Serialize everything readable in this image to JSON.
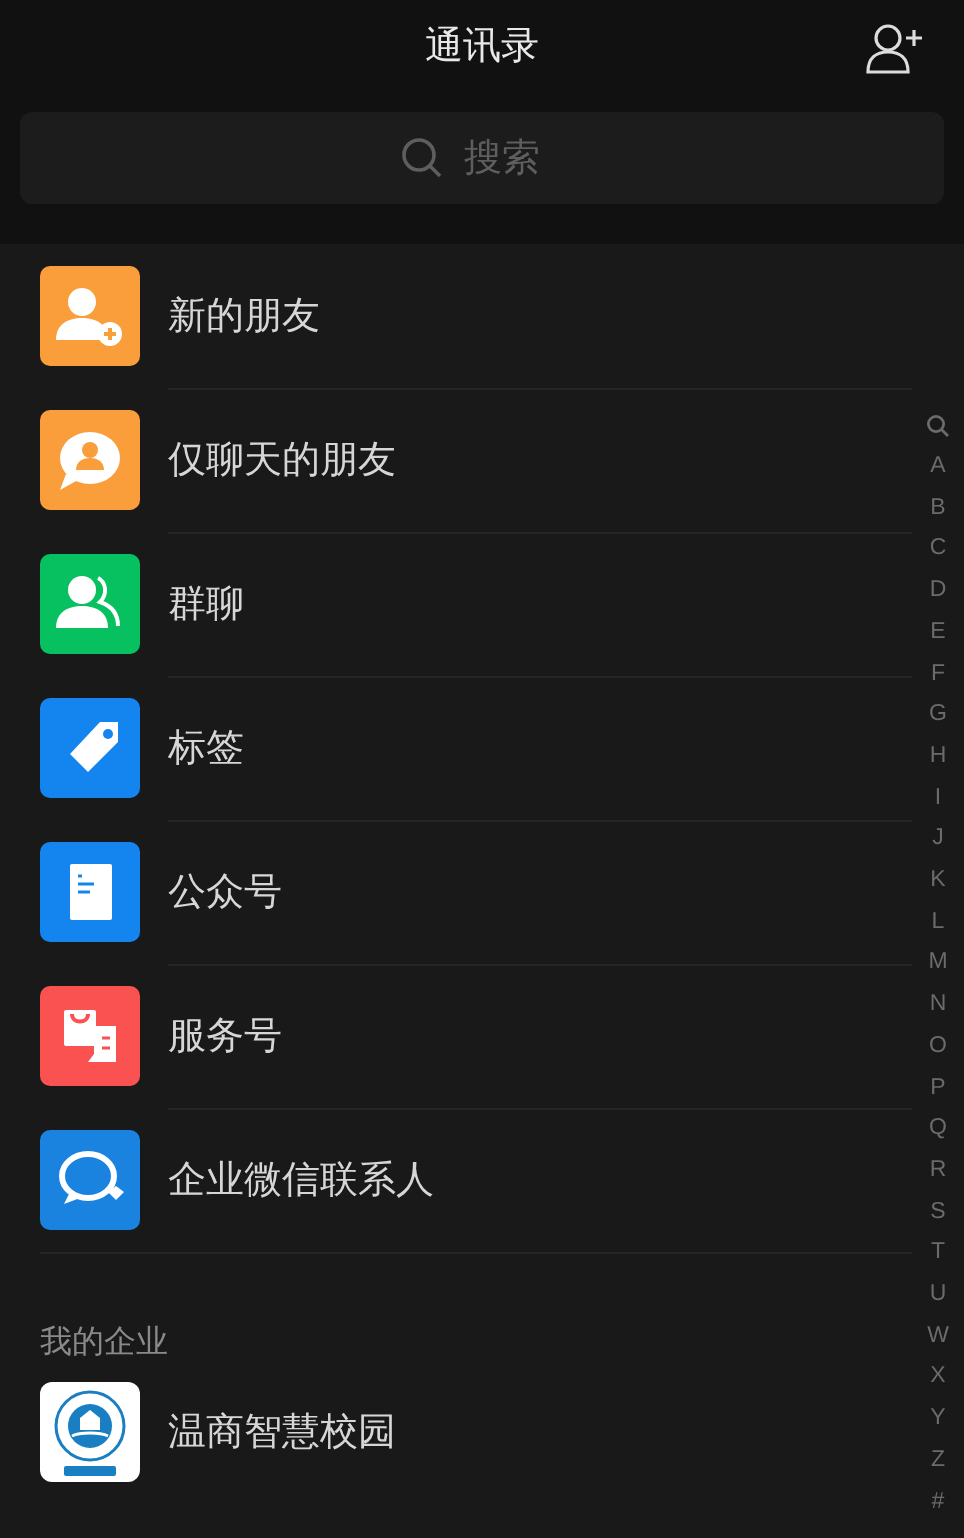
{
  "header": {
    "title": "通讯录"
  },
  "search": {
    "placeholder": "搜索"
  },
  "items": [
    {
      "label": "新的朋友",
      "kind": "add-person",
      "color": "#fa9d3b"
    },
    {
      "label": "仅聊天的朋友",
      "kind": "chat-person",
      "color": "#fa9d3b"
    },
    {
      "label": "群聊",
      "kind": "group",
      "color": "#07c160"
    },
    {
      "label": "标签",
      "kind": "tag",
      "color": "#1485ee"
    },
    {
      "label": "公众号",
      "kind": "document",
      "color": "#1485ee"
    },
    {
      "label": "服务号",
      "kind": "shop",
      "color": "#fa5151"
    },
    {
      "label": "企业微信联系人",
      "kind": "chat-bubbles",
      "color": "#1a83e0"
    }
  ],
  "section": {
    "title": "我的企业",
    "items": [
      {
        "label": "温商智慧校园",
        "kind": "badge-logo"
      }
    ]
  },
  "index": [
    "A",
    "B",
    "C",
    "D",
    "E",
    "F",
    "G",
    "H",
    "I",
    "J",
    "K",
    "L",
    "M",
    "N",
    "O",
    "P",
    "Q",
    "R",
    "S",
    "T",
    "U",
    "W",
    "X",
    "Y",
    "Z",
    "#"
  ]
}
